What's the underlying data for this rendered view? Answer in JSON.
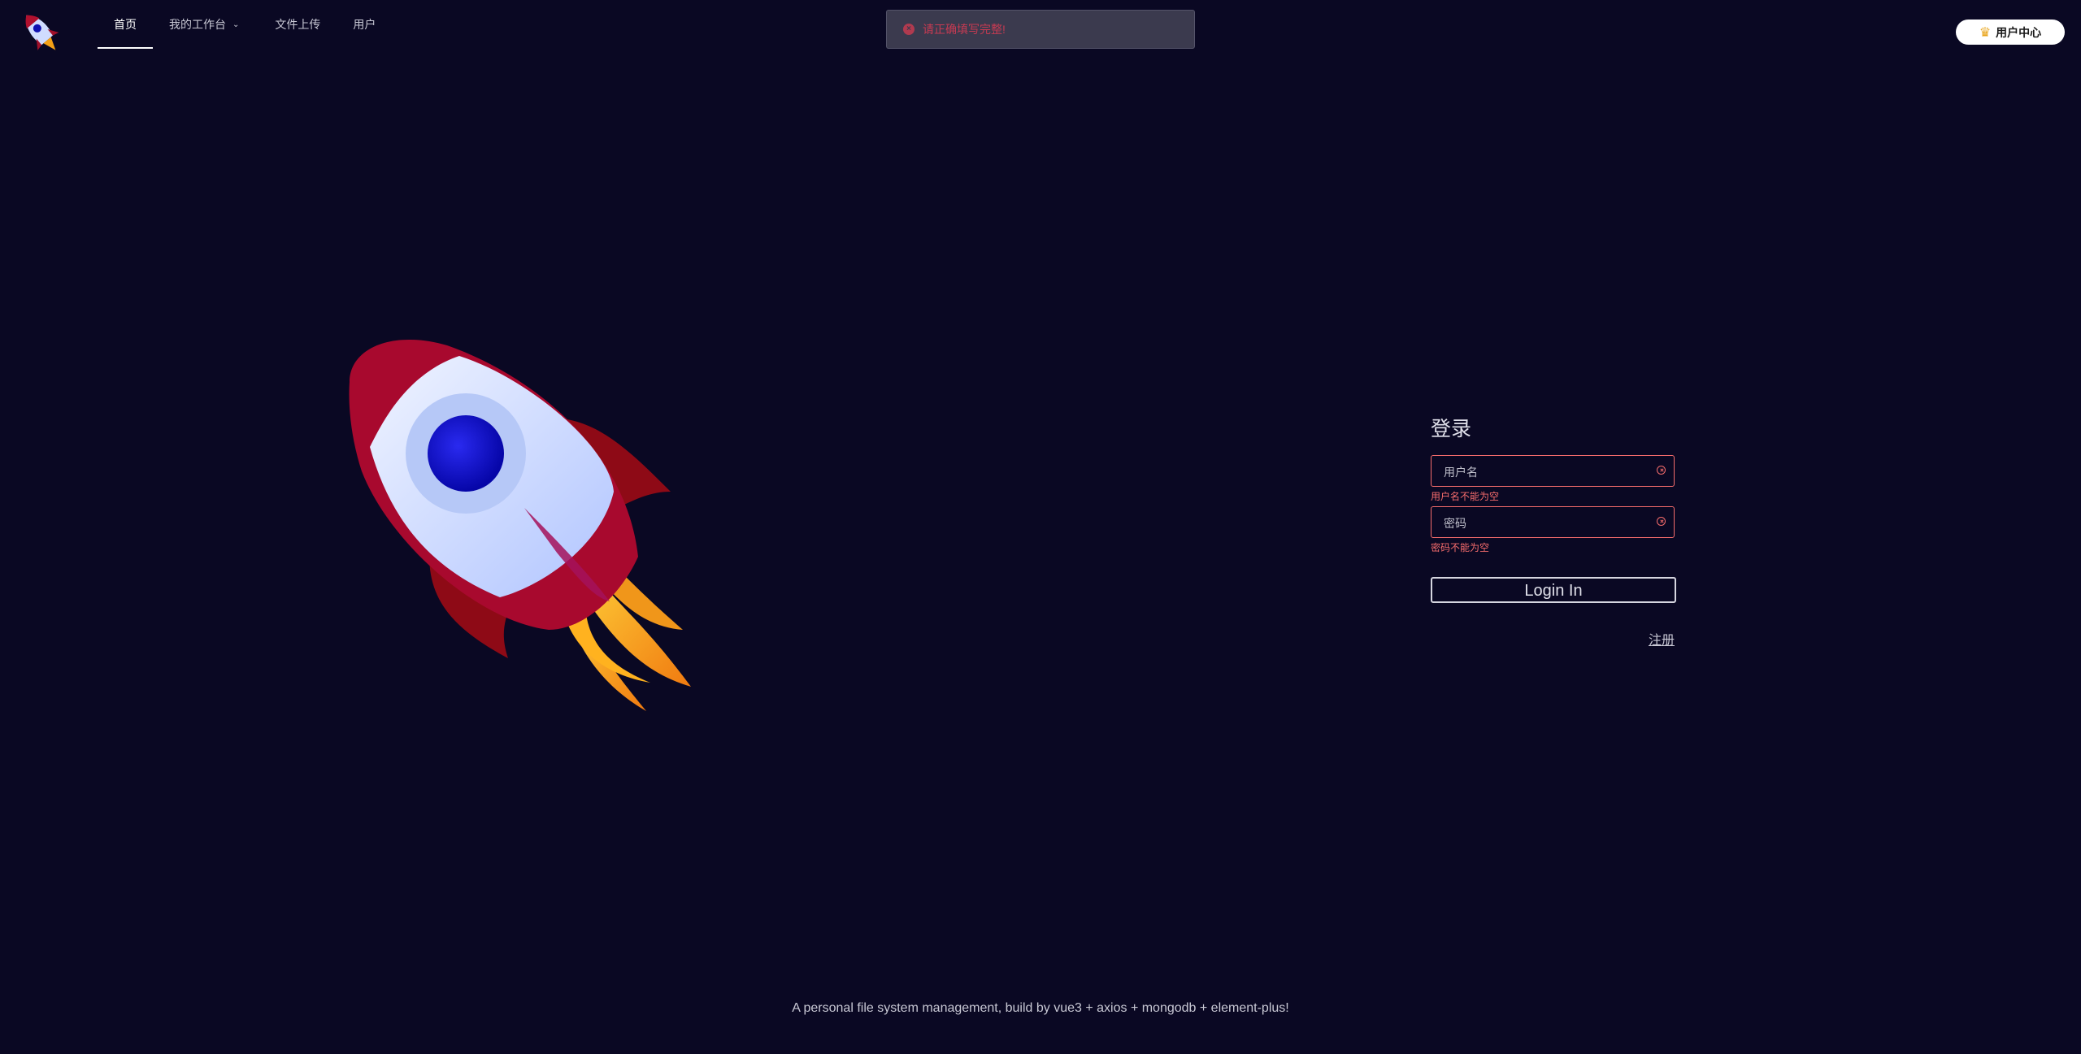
{
  "header": {
    "nav": [
      {
        "label": "首页",
        "active": true
      },
      {
        "label": "我的工作台",
        "has_dropdown": true
      },
      {
        "label": "文件上传"
      },
      {
        "label": "用户"
      }
    ],
    "user_center_label": "用户中心"
  },
  "toast": {
    "message": "请正确填写完整!",
    "type": "error"
  },
  "login": {
    "title": "登录",
    "username": {
      "placeholder": "用户名",
      "value": "",
      "error": "用户名不能为空"
    },
    "password": {
      "placeholder": "密码",
      "value": "",
      "error": "密码不能为空"
    },
    "submit_label": "Login In",
    "register_link": "注册"
  },
  "footer": {
    "text": "A personal file system management, build by vue3 + axios + mongodb + element-plus!"
  },
  "colors": {
    "background": "#0a0823",
    "error": "#f56c6c",
    "rocket_red": "#a8092e",
    "rocket_body": "#c8d8ff",
    "window": "#0a0ac8"
  }
}
